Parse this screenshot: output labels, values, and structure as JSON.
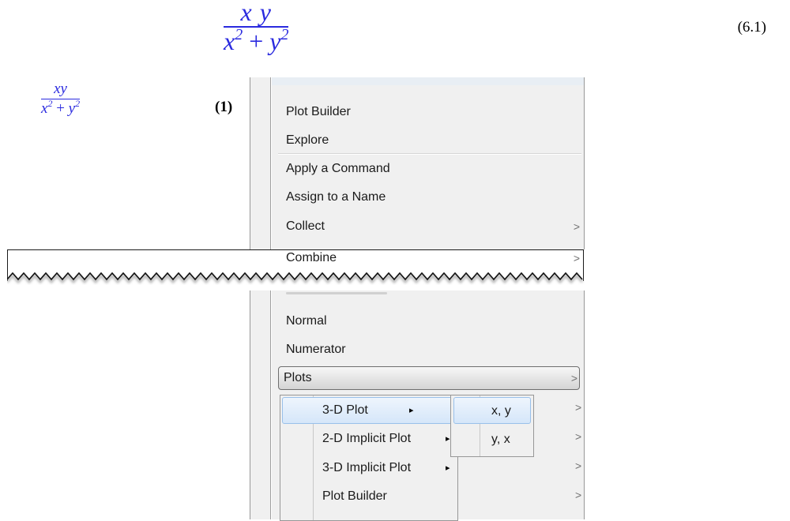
{
  "equations": {
    "top": {
      "numerator": "x y",
      "denominator_x": "x",
      "denominator_op": " + ",
      "denominator_y": "y",
      "exp": "2",
      "label": "(6.1)"
    },
    "small": {
      "numerator": "xy",
      "denominator_x": "x",
      "denominator_op": " + ",
      "denominator_y": "y",
      "exp": "2",
      "label": "(1)"
    }
  },
  "menu": {
    "items_top": [
      "Plot Builder",
      "Explore",
      "Apply a Command",
      "Assign to a Name",
      "Collect",
      "Combine"
    ],
    "items_bottom": [
      "Normal",
      "Numerator",
      "Plots"
    ],
    "submenu_arrow": ">"
  },
  "submenu_plots": {
    "items": [
      "3-D Plot",
      "2-D Implicit Plot",
      "3-D Implicit Plot",
      "Plot Builder"
    ],
    "triangle": "▸"
  },
  "submenu_3dplot": {
    "items": [
      "x, y",
      "y, x"
    ]
  },
  "colors": {
    "math_blue": "#2a2adf",
    "menu_bg": "#f0f0f0",
    "highlight_border": "#99c0ea"
  }
}
